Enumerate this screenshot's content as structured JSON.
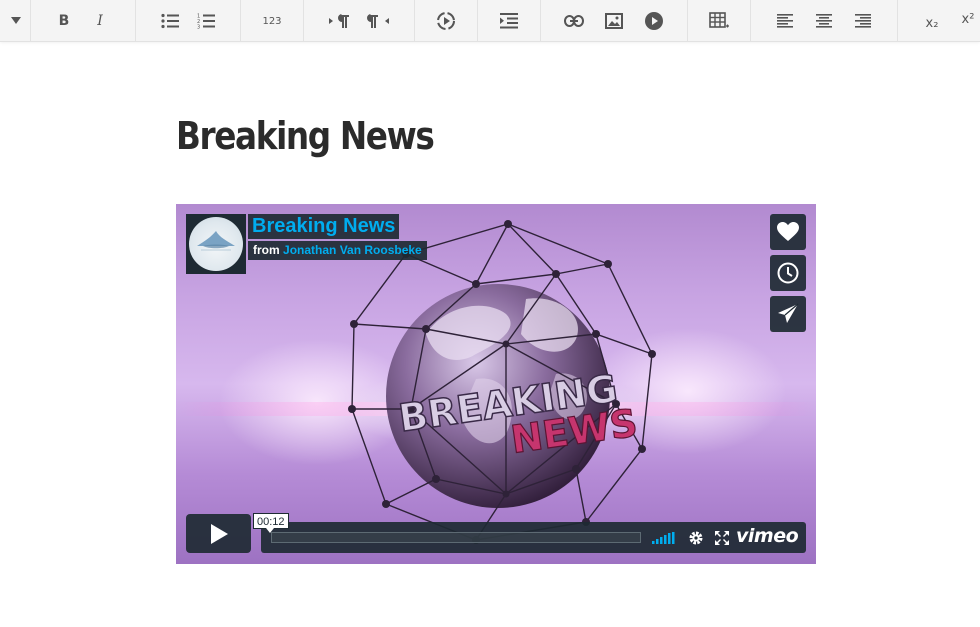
{
  "toolbar": {
    "format_dropdown": "format-dropdown",
    "bold_label": "B",
    "italic_label": "I",
    "numbers_label": "123",
    "subscript_label": "x₂",
    "superscript_label": "x²"
  },
  "document": {
    "title": "Breaking News"
  },
  "video": {
    "title": "Breaking News",
    "from_label": "from",
    "author": "Jonathan Van Roosbeke",
    "timecode": "00:12",
    "progress": 0,
    "brand": "vimeo",
    "overlay_text_1": "BREAKING",
    "overlay_text_2": "NEWS",
    "accent_color": "#00adef",
    "panel_color": "#1e2a33"
  }
}
